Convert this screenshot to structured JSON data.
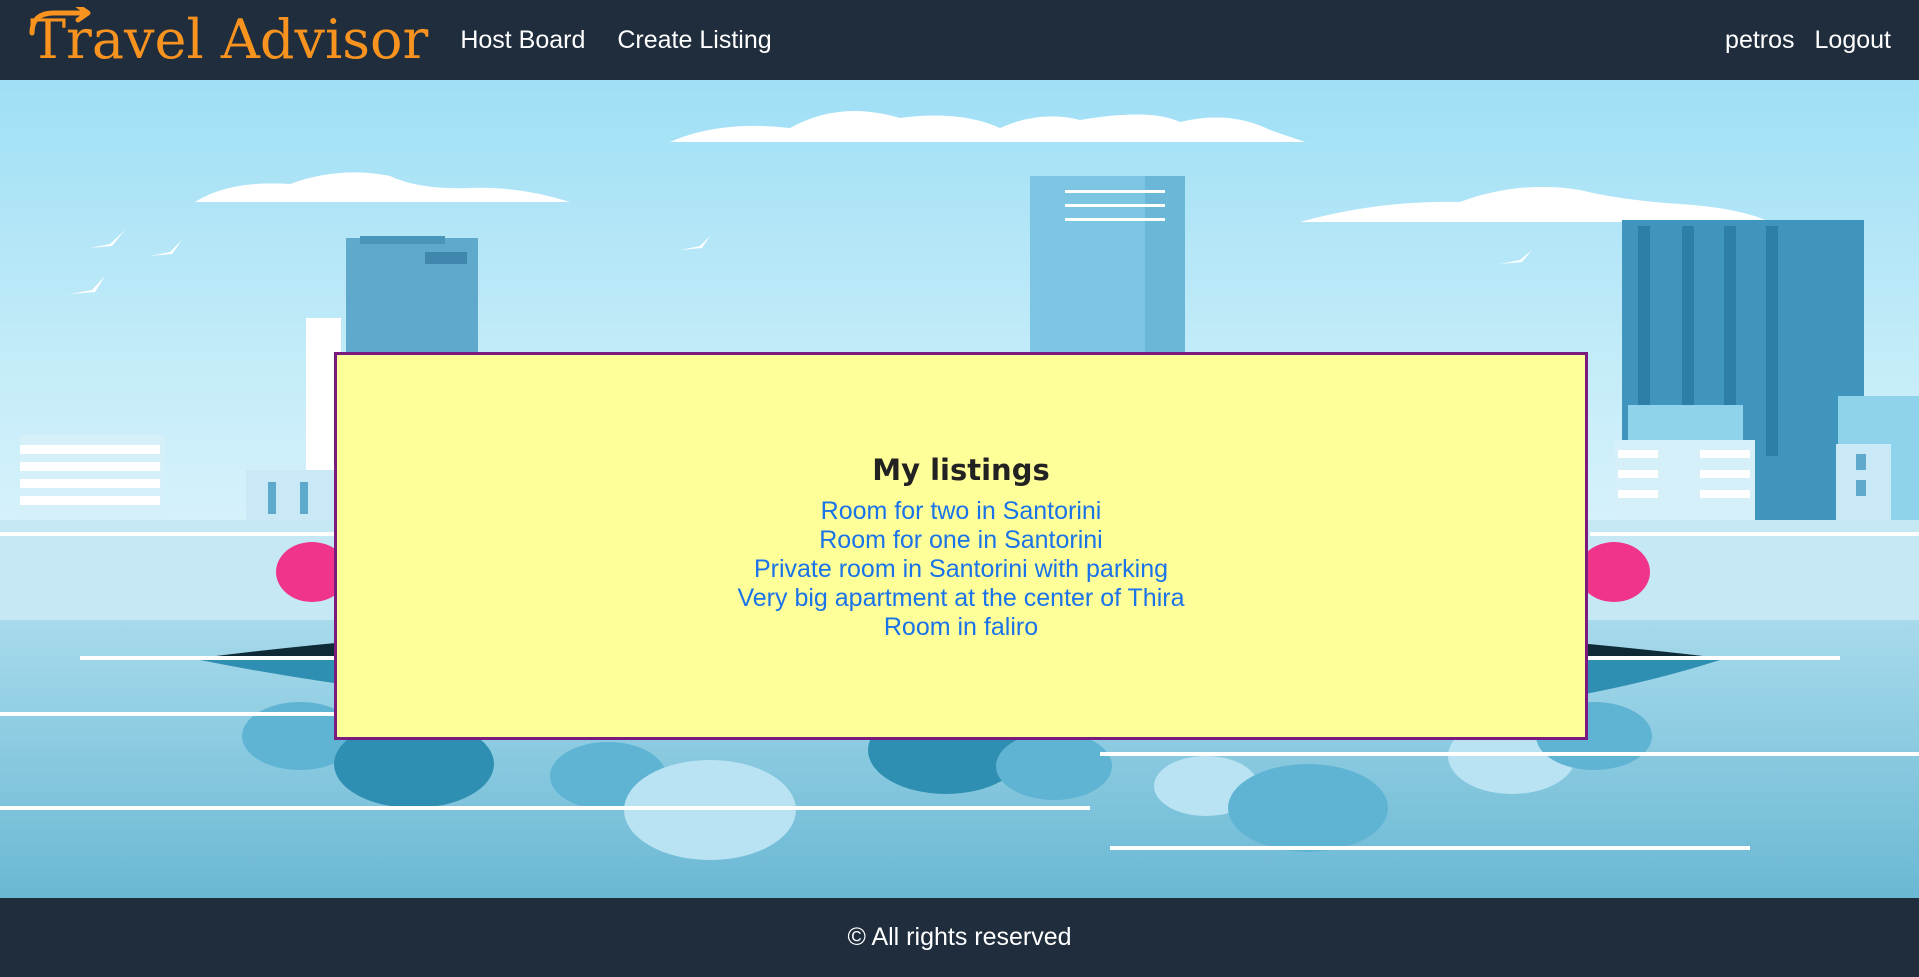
{
  "navbar": {
    "brand": "Travel Advisor",
    "links": [
      "Host Board",
      "Create Listing"
    ],
    "user": "petros",
    "logout": "Logout"
  },
  "main": {
    "title": "My listings",
    "listings": [
      "Room for two in Santorini",
      "Room for one in Santorini",
      "Private room in Santorini with parking",
      "Very big apartment at the center of Thira",
      "Room in faliro"
    ]
  },
  "footer": {
    "text": "© All rights reserved"
  },
  "colors": {
    "navbar_bg": "#1f2d3d",
    "brand": "#f7931e",
    "card_bg": "#ffff99",
    "card_border": "#7b1a7f",
    "link": "#1a73e8"
  }
}
